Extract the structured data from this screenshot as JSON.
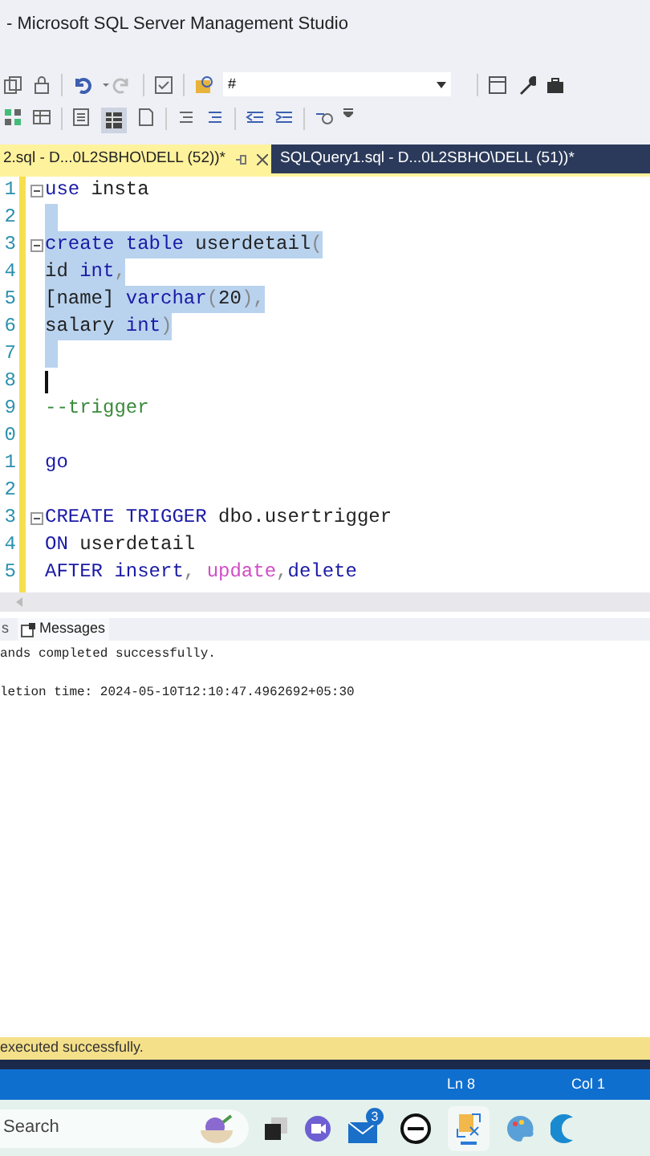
{
  "window": {
    "title": "- Microsoft SQL Server Management Studio"
  },
  "toolbar": {
    "search_value": "#"
  },
  "tabs": [
    {
      "label": "2.sql - D...0L2SBHO\\DELL (52))*",
      "selected": true
    },
    {
      "label": "SQLQuery1.sql - D...0L2SBHO\\DELL (51))*",
      "selected": false
    }
  ],
  "editor": {
    "lines": [
      {
        "number": "1",
        "selected": false,
        "fold": true,
        "tokens": [
          {
            "kind": "keyword",
            "text": "use"
          },
          {
            "kind": "ident",
            "text": " insta"
          }
        ]
      },
      {
        "number": "2",
        "selected": true,
        "fold": false
      },
      {
        "number": "3",
        "selected": true,
        "fold": true,
        "tokens": [
          {
            "kind": "keyword",
            "text": "create table"
          },
          {
            "kind": "ident",
            "text": " userdetail"
          },
          {
            "kind": "punct",
            "text": "("
          }
        ]
      },
      {
        "number": "4",
        "selected": true,
        "fold": false,
        "tokens": [
          {
            "kind": "ident",
            "text": "id "
          },
          {
            "kind": "keyword",
            "text": "int"
          },
          {
            "kind": "punct",
            "text": ","
          }
        ]
      },
      {
        "number": "5",
        "selected": true,
        "fold": false,
        "tokens": [
          {
            "kind": "ident",
            "text": "[name] "
          },
          {
            "kind": "keyword",
            "text": "varchar"
          },
          {
            "kind": "punct",
            "text": "("
          },
          {
            "kind": "ident",
            "text": "20"
          },
          {
            "kind": "punct",
            "text": "),"
          }
        ]
      },
      {
        "number": "6",
        "selected": true,
        "fold": false,
        "tokens": [
          {
            "kind": "ident",
            "text": "salary "
          },
          {
            "kind": "keyword",
            "text": "int"
          },
          {
            "kind": "punct",
            "text": ")"
          }
        ]
      },
      {
        "number": "7",
        "selected": true,
        "fold": false
      },
      {
        "number": "8",
        "selected": false,
        "fold": false,
        "caret": true
      },
      {
        "number": "9",
        "selected": false,
        "fold": false,
        "tokens": [
          {
            "kind": "comment",
            "text": "--trigger"
          }
        ]
      },
      {
        "number": "0",
        "selected": false,
        "fold": false
      },
      {
        "number": "1",
        "selected": false,
        "fold": false,
        "tokens": [
          {
            "kind": "keyword",
            "text": "go"
          }
        ]
      },
      {
        "number": "2",
        "selected": false,
        "fold": false
      },
      {
        "number": "3",
        "selected": false,
        "fold": true,
        "tokens": [
          {
            "kind": "keyword",
            "text": "CREATE TRIGGER"
          },
          {
            "kind": "ident",
            "text": " dbo.usertrigger"
          }
        ]
      },
      {
        "number": "4",
        "selected": false,
        "fold": false,
        "tokens": [
          {
            "kind": "keyword",
            "text": "ON"
          },
          {
            "kind": "ident",
            "text": " userdetail"
          }
        ]
      },
      {
        "number": "5",
        "selected": false,
        "fold": false,
        "tokens": [
          {
            "kind": "keyword",
            "text": "AFTER insert"
          },
          {
            "kind": "punct",
            "text": ", "
          },
          {
            "kind": "func",
            "text": "update"
          },
          {
            "kind": "punct",
            "text": ","
          },
          {
            "kind": "keyword",
            "text": "delete"
          }
        ]
      }
    ]
  },
  "results": {
    "tabs": [
      {
        "label": "s",
        "selected": false
      },
      {
        "label": "Messages",
        "selected": true
      }
    ],
    "messages": [
      "ands completed successfully.",
      "letion time: 2024-05-10T12:10:47.4962692+05:30"
    ]
  },
  "query_status": "executed successfully.",
  "status_bar": {
    "line": "Ln 8",
    "column": "Col 1"
  },
  "taskbar": {
    "search_placeholder": "Search",
    "mail_badge": "3"
  }
}
